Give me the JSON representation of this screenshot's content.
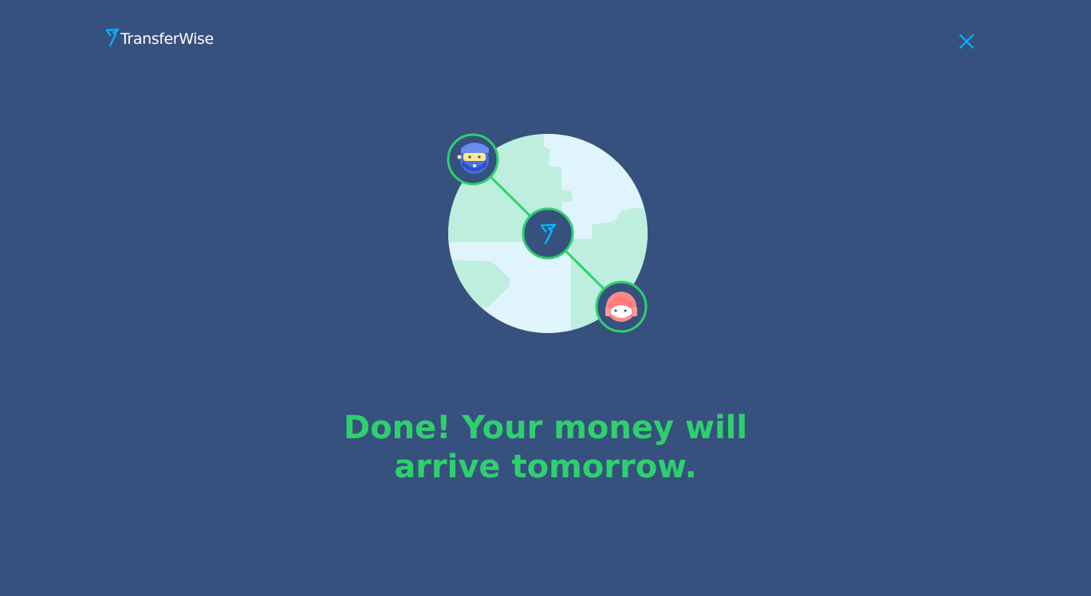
{
  "brand": {
    "name": "TransferWise",
    "logo_icon": "transferwise-flag-icon"
  },
  "header": {
    "close_icon": "close-icon"
  },
  "illustration": {
    "sender_avatar": "bearded-man-avatar-icon",
    "center_icon": "transferwise-flag-icon",
    "recipient_avatar": "woman-avatar-icon",
    "globe": "globe-icon"
  },
  "message": {
    "line1": "Done! Your money will",
    "line2": "arrive tomorrow."
  },
  "colors": {
    "background": "#37517e",
    "accent_green": "#2ed06e",
    "accent_blue": "#00b9ff",
    "globe_ocean": "#dff5fb",
    "globe_land": "#bdeede"
  }
}
